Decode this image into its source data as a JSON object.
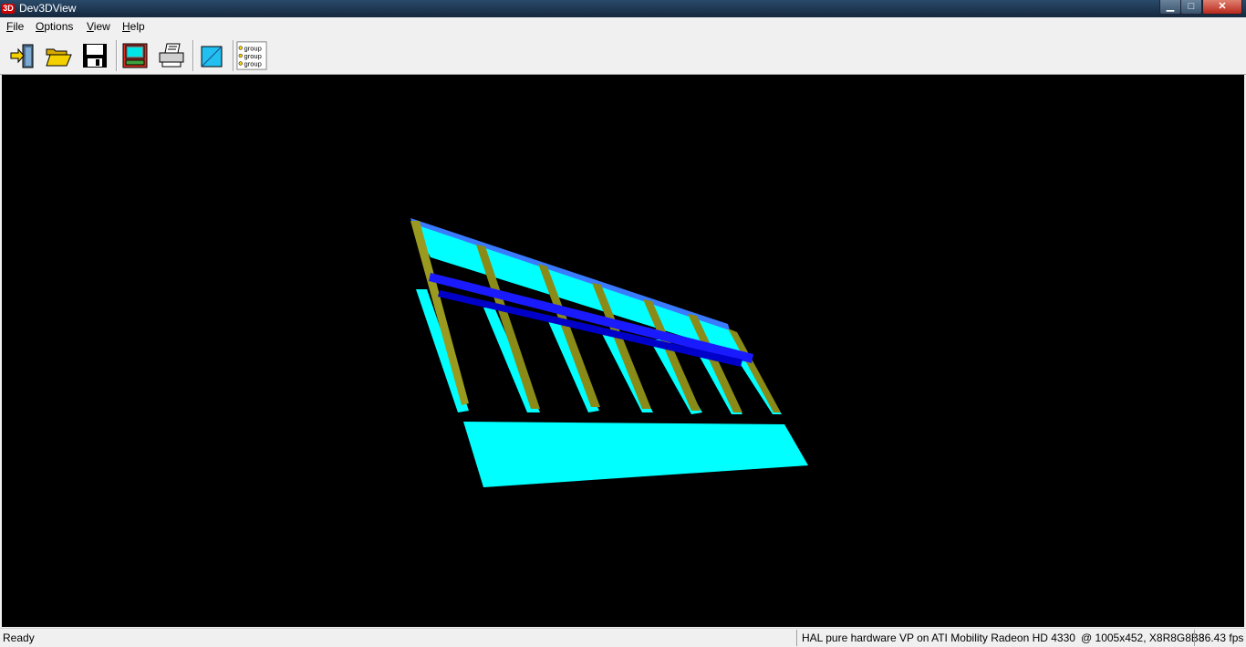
{
  "window": {
    "title": "Dev3DView",
    "icon": "3D"
  },
  "window_controls": {
    "minimize": "minimize-icon",
    "maximize": "maximize-icon",
    "close": "close-icon"
  },
  "menu": [
    "File",
    "Options",
    "View",
    "Help"
  ],
  "toolbar": {
    "icons": [
      "exit-icon",
      "open-folder-icon",
      "save-disk-icon",
      "monitor-icon",
      "printer-icon",
      "viewport-icon",
      "group-tree-icon"
    ],
    "group_labels": [
      "group",
      "group",
      "group"
    ]
  },
  "colors": {
    "viewport_bg": "#000000",
    "panel_cyan": "#00ffff",
    "beam_blue": "#1a1aff",
    "post_olive": "#9a9a20"
  },
  "status": {
    "ready": "Ready",
    "device": "HAL pure hardware VP on ATI Mobility Radeon HD 4330",
    "mode": "@ 1005x452, X8R8G8B8",
    "fps": "36.43 fps"
  }
}
